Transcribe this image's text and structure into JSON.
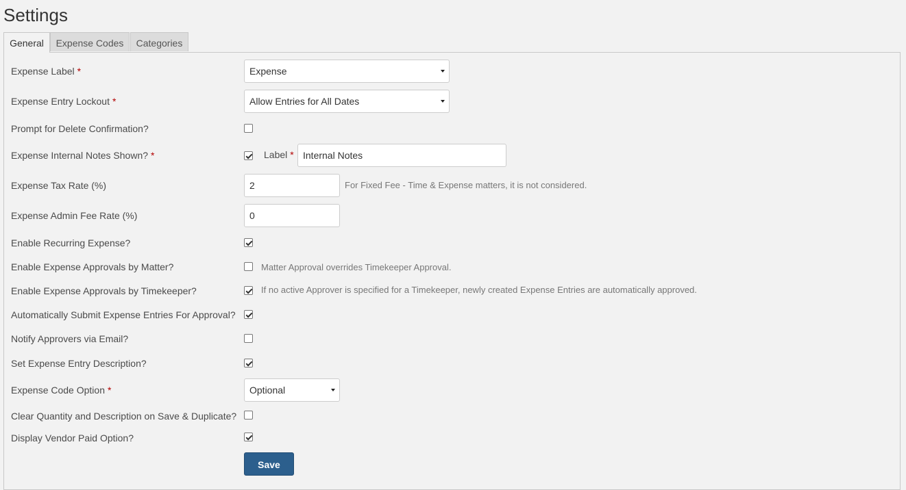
{
  "page": {
    "title": "Settings"
  },
  "tabs": [
    {
      "label": "General",
      "active": true
    },
    {
      "label": "Expense Codes",
      "active": false
    },
    {
      "label": "Categories",
      "active": false
    }
  ],
  "form": {
    "required_mark": "*",
    "expense_label": {
      "label": "Expense Label",
      "value": "Expense"
    },
    "entry_lockout": {
      "label": "Expense Entry Lockout",
      "value": "Allow Entries for All Dates"
    },
    "delete_confirmation": {
      "label": "Prompt for Delete Confirmation?",
      "checked": false
    },
    "internal_notes": {
      "label": "Expense Internal Notes Shown?",
      "checked": true,
      "sub_label": "Label",
      "sub_value": "Internal Notes"
    },
    "tax_rate": {
      "label": "Expense Tax Rate (%)",
      "value": "2",
      "help": "For Fixed Fee - Time & Expense matters, it is not considered."
    },
    "admin_fee_rate": {
      "label": "Expense Admin Fee Rate (%)",
      "value": "0"
    },
    "recurring": {
      "label": "Enable Recurring Expense?",
      "checked": true
    },
    "approvals_matter": {
      "label": "Enable Expense Approvals by Matter?",
      "checked": false,
      "help": "Matter Approval overrides Timekeeper Approval."
    },
    "approvals_timekeeper": {
      "label": "Enable Expense Approvals by Timekeeper?",
      "checked": true,
      "help": "If no active Approver is specified for a Timekeeper, newly created Expense Entries are automatically approved."
    },
    "auto_submit": {
      "label": "Automatically Submit Expense Entries For Approval?",
      "checked": true
    },
    "notify_email": {
      "label": "Notify Approvers via Email?",
      "checked": false
    },
    "set_description": {
      "label": "Set Expense Entry Description?",
      "checked": true
    },
    "code_option": {
      "label": "Expense Code Option",
      "value": "Optional"
    },
    "clear_on_save": {
      "label": "Clear Quantity and Description on Save & Duplicate?",
      "checked": false
    },
    "vendor_paid": {
      "label": "Display Vendor Paid Option?",
      "checked": true
    },
    "save_label": "Save"
  },
  "colors": {
    "primary_button": "#2c5f8d",
    "required": "#b30000",
    "background": "#f2f2f2"
  }
}
